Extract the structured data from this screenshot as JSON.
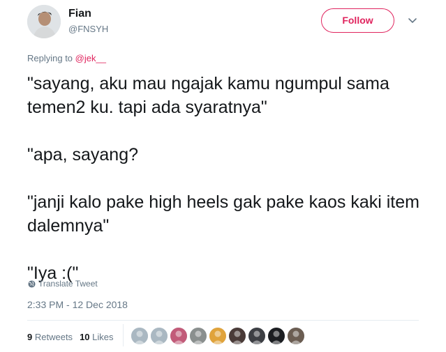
{
  "user": {
    "name": "Fian",
    "handle": "@FNSYH"
  },
  "follow_label": "Follow",
  "reply": {
    "prefix": "Replying to ",
    "mention": "@jek__"
  },
  "tweet_text": "\"sayang, aku mau ngajak kamu ngumpul sama temen2 ku. tapi ada syaratnya\"\n\n\"apa, sayang?\n\n\"janji kalo pake high heels gak pake kaos kaki item dalemnya\"\n\n\"Iya :(\"",
  "translate_label": "Translate Tweet",
  "timestamp": "2:33 PM - 12 Dec 2018",
  "stats": {
    "retweets_count": "9",
    "retweets_label": "Retweets",
    "likes_count": "10",
    "likes_label": "Likes"
  },
  "colors": {
    "accent": "#e0245e",
    "secondary_text": "#657786",
    "primary_text": "#14171a"
  },
  "icons": [
    "chevron-down-icon",
    "globe-icon"
  ],
  "liker_avatars": [
    {
      "color": "#aab8c2"
    },
    {
      "color": "#aab8c2"
    },
    {
      "color": "#c25b79"
    },
    {
      "color": "#8a8f8e"
    },
    {
      "color": "#e0a33b"
    },
    {
      "color": "#4a3b38"
    },
    {
      "color": "#3d3f44"
    },
    {
      "color": "#1c1e22"
    },
    {
      "color": "#6b5d52"
    }
  ]
}
